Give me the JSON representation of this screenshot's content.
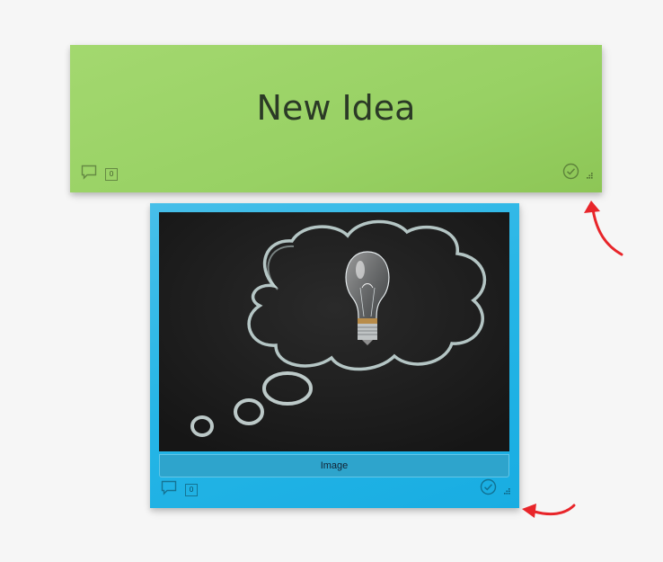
{
  "cards": [
    {
      "title": "New Idea",
      "color": "#9ad265",
      "comment_count": "0"
    },
    {
      "caption": "Image",
      "color": "#25b5e6",
      "comment_count": "0",
      "image_subject": "lightbulb-thought-bubble-chalkboard"
    }
  ],
  "annotations": {
    "arrow_color": "#e8252a"
  }
}
